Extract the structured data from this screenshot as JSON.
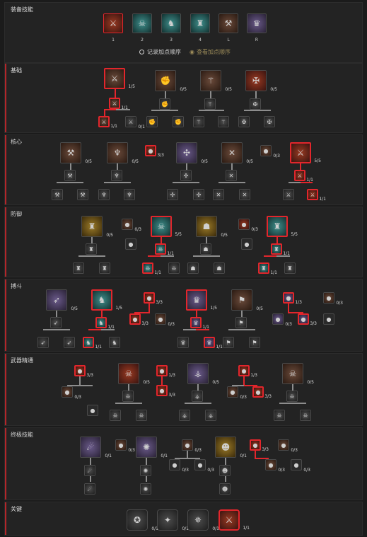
{
  "equipped": {
    "title": "装备技能",
    "slots": [
      {
        "key": "1",
        "icon": "shield-bash-icon",
        "color": "red"
      },
      {
        "key": "2",
        "icon": "ghost-wolf-icon",
        "color": "teal"
      },
      {
        "key": "3",
        "icon": "iron-skin-icon",
        "color": "teal"
      },
      {
        "key": "4",
        "icon": "warcry-icon",
        "color": "teal"
      },
      {
        "key": "L",
        "icon": "cleave-icon",
        "color": "brown"
      },
      {
        "key": "R",
        "icon": "war-horn-icon",
        "color": "purple"
      }
    ],
    "record_label": "记录加点顺序",
    "view_label": "查看加点顺序"
  },
  "sections": [
    {
      "title": "基础"
    },
    {
      "title": "核心"
    },
    {
      "title": "防御"
    },
    {
      "title": "搏斗"
    },
    {
      "title": "武器精通"
    },
    {
      "title": "终极技能"
    },
    {
      "title": "关键"
    }
  ],
  "counts": {
    "c_1_5": "1/5",
    "c_0_5": "0/5",
    "c_1_1": "1/1",
    "c_0_1": "0/1",
    "c_5_5": "5/5",
    "c_3_3": "3/3",
    "c_0_3": "0/3",
    "c_1_3": "1/3"
  }
}
